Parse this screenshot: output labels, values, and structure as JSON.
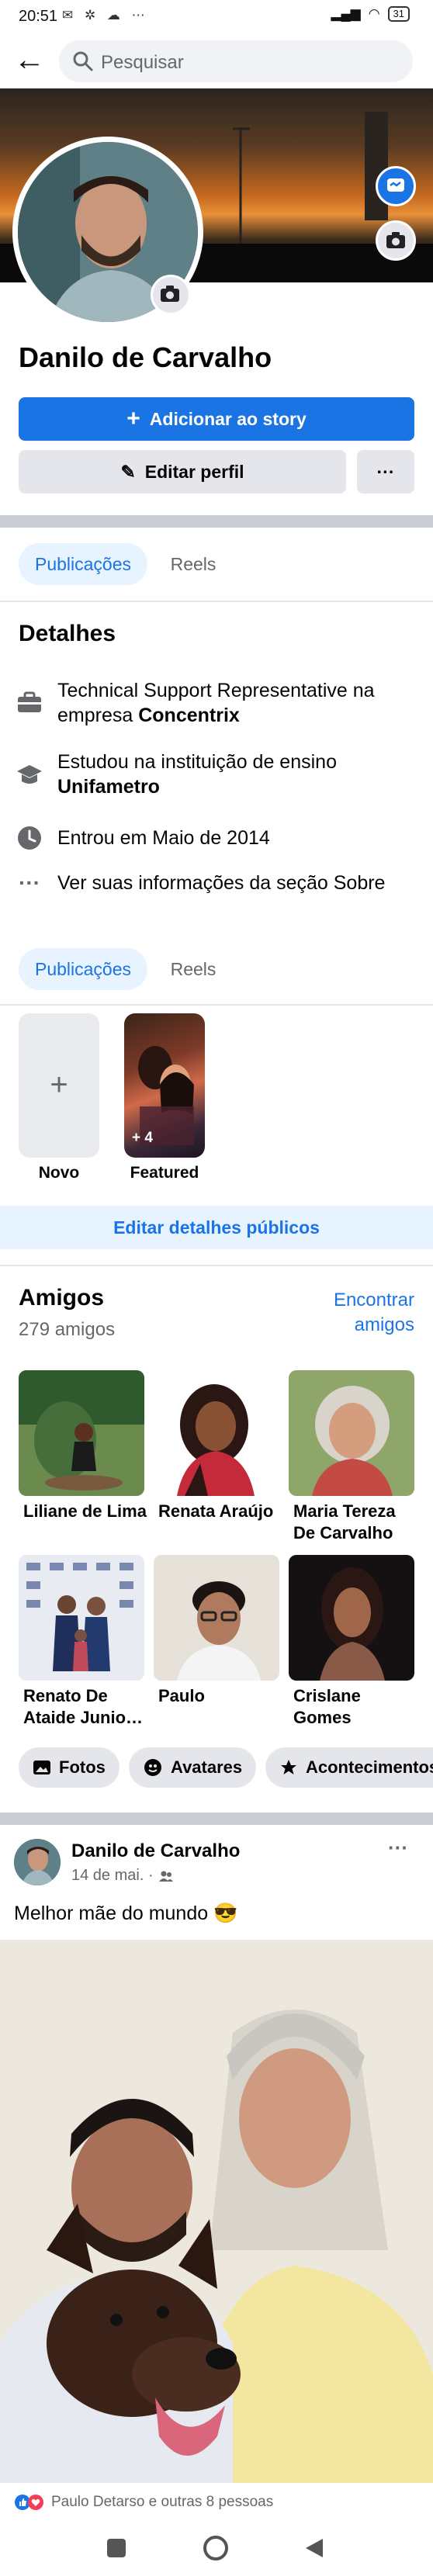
{
  "status_bar": {
    "time": "20:51",
    "battery": "31"
  },
  "search": {
    "placeholder": "Pesquisar"
  },
  "profile": {
    "name": "Danilo de Carvalho",
    "add_story_label": "Adicionar ao story",
    "edit_profile_label": "Editar perfil",
    "more_label": "···"
  },
  "tabs_top": [
    "Publicações",
    "Reels"
  ],
  "details": {
    "title": "Detalhes",
    "work_prefix": "Technical Support Representative na empresa ",
    "work_company": "Concentrix",
    "study_prefix": "Estudou na instituição de ensino ",
    "study_school": "Unifametro",
    "joined": "Entrou em Maio de 2014",
    "about": "Ver suas informações da seção Sobre"
  },
  "tabs_bottom": [
    "Publicações",
    "Reels"
  ],
  "featured": {
    "new_label": "Novo",
    "featured_label": "Featured",
    "featured_count": "+ 4"
  },
  "edit_public_label": "Editar detalhes públicos",
  "friends": {
    "title": "Amigos",
    "count": "279 amigos",
    "find_label": "Encontrar amigos",
    "list": [
      {
        "name": "Liliane de Lima"
      },
      {
        "name": "Renata Araújo"
      },
      {
        "name": "Maria Tereza De Carvalho"
      },
      {
        "name": "Renato De Ataide Junio…"
      },
      {
        "name": "Paulo"
      },
      {
        "name": "Crislane Gomes"
      }
    ]
  },
  "chips": [
    "Fotos",
    "Avatares",
    "Acontecimentos"
  ],
  "post": {
    "author": "Danilo de Carvalho",
    "date": "14 de mai. ·",
    "text": "Melhor mãe do mundo 😎",
    "reactions": "Paulo Detarso e outras 8 pessoas"
  },
  "colors": {
    "accent": "#1b74e4",
    "accent_bg": "#e7f3ff",
    "button_grey": "#e4e6eb"
  }
}
